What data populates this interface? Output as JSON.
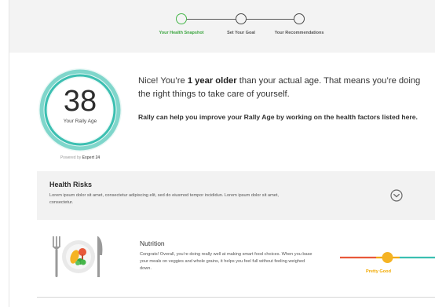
{
  "stepper": {
    "steps": [
      {
        "label": "Your Health Snapshot",
        "active": true
      },
      {
        "label": "Set Your Goal",
        "active": false
      },
      {
        "label": "Your Recommendations",
        "active": false
      }
    ]
  },
  "snapshot": {
    "age_value": "38",
    "age_label": "Your Rally Age",
    "powered_prefix": "Powered by",
    "powered_brand": "Expert 24",
    "message_pre": "Nice! You’re ",
    "message_bold": "1 year older",
    "message_post": " than your actual age. That means you’re doing the right things to take care of yourself.",
    "sub_message": "Rally can help you improve your Rally Age by working on the health factors listed here."
  },
  "health_risks": {
    "title": "Health Risks",
    "description": "Lorem ipsum dolor sit amet, consectetur adipiscing elit, sed do eiusmod tempor incididun. Lorem ipsum dolor sit amet, consectetur."
  },
  "nutrition": {
    "title": "Nutrition",
    "description": "Congrats! Overall, you’re doing really well at making smart food choices. When you base your meals on veggies and whole grains, it helps you feel full without feeling weighed down.",
    "rating_label": "Pretty Good",
    "rating_level": 0.5
  },
  "colors": {
    "accent_green": "#45b649",
    "teal": "#3bbfb1",
    "rating_orange": "#f2a900",
    "meter_red": "#e8583a"
  },
  "icons": [
    "expand-chevron-icon",
    "plate-cutlery-icon"
  ]
}
